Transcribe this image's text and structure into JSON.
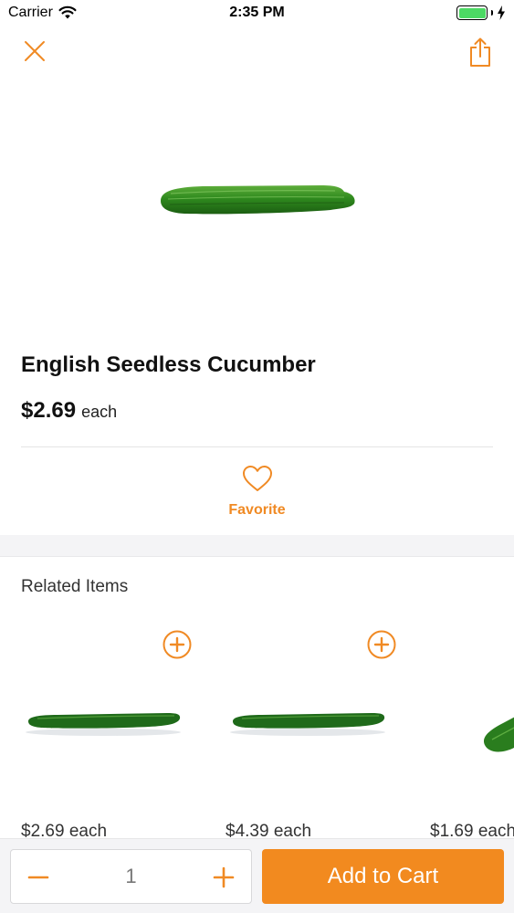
{
  "status_bar": {
    "carrier": "Carrier",
    "time": "2:35 PM",
    "battery_level": 1.0,
    "icons": [
      "wifi-icon",
      "battery-icon",
      "charging-bolt-icon"
    ]
  },
  "nav": {
    "close_icon": "close-icon",
    "share_icon": "share-icon"
  },
  "product": {
    "title": "English Seedless Cucumber",
    "price": "$2.69",
    "price_unit": "each",
    "favorite_label": "Favorite",
    "favorite_icon": "heart-icon"
  },
  "related": {
    "title": "Related Items",
    "items": [
      {
        "price": "$2.69 each",
        "add_icon": "plus-circle-icon"
      },
      {
        "price": "$4.39 each",
        "add_icon": "plus-circle-icon"
      },
      {
        "price": "$1.69 each",
        "add_icon": "plus-circle-icon"
      }
    ]
  },
  "cart_bar": {
    "quantity": "1",
    "minus_icon": "minus-icon",
    "plus_icon": "plus-icon",
    "add_to_cart_label": "Add to Cart"
  },
  "colors": {
    "accent": "#f28a1f",
    "favorite_text": "#f08a24",
    "battery": "#4cd964",
    "section_bg": "#f4f4f6"
  }
}
